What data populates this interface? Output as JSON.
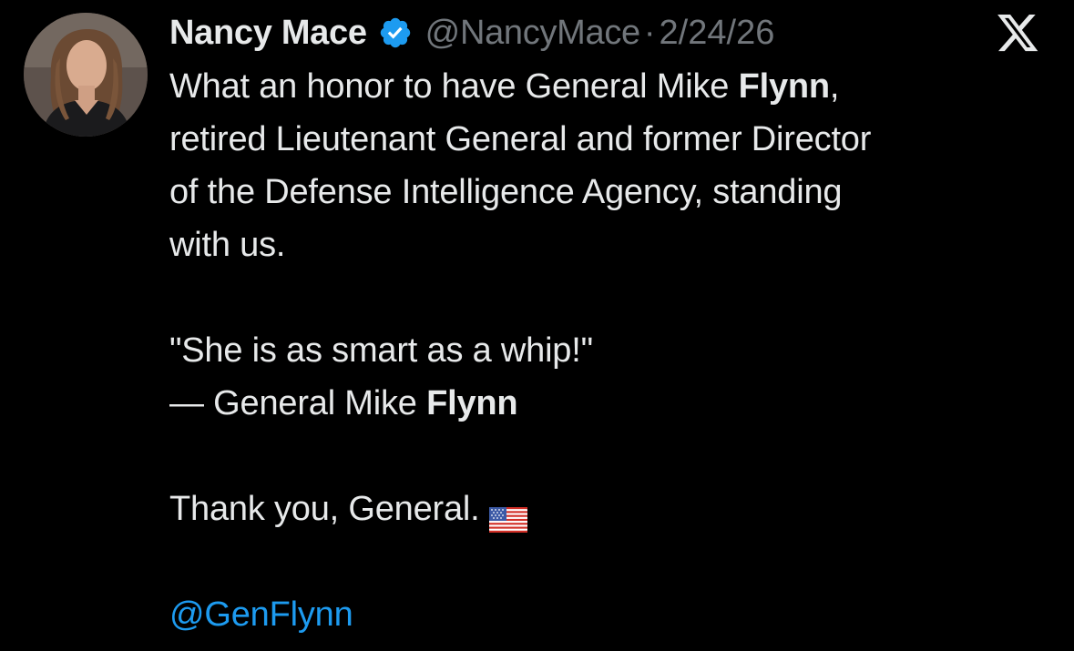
{
  "tweet": {
    "author": {
      "name": "Nancy Mace",
      "handle": "@NancyMace",
      "verified": true
    },
    "separator": "·",
    "date": "2/24/26",
    "platform_logo": "x-logo-icon",
    "text": {
      "line1_a": "What an honor to have General Mike ",
      "line1_bold": "Flynn",
      "line1_b": ",",
      "line2": "retired Lieutenant General and former Director",
      "line3": "of the Defense Intelligence Agency, standing",
      "line4": "with us.",
      "quote": "\"She is as smart as a whip!\"",
      "attribution_prefix": "— General Mike ",
      "attribution_bold": "Flynn",
      "thanks": "Thank you, General.",
      "mention": "@GenFlynn"
    },
    "colors": {
      "background": "#000000",
      "text": "#e7e9ea",
      "muted": "#71767b",
      "link": "#1d9bf0",
      "verified": "#1d9bf0"
    }
  }
}
